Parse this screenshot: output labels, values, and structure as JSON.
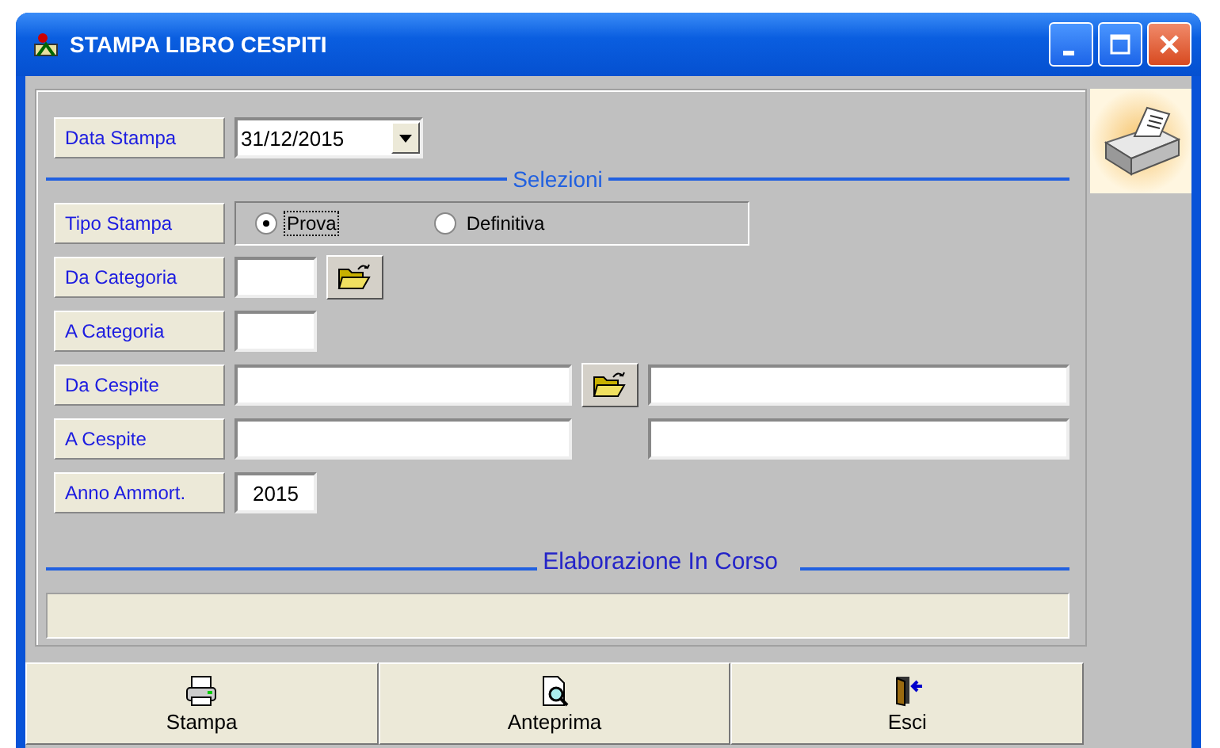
{
  "window": {
    "title": "STAMPA LIBRO CESPITI"
  },
  "data_stampa": {
    "label": "Data Stampa",
    "value": "31/12/2015"
  },
  "selezioni": {
    "title": "Selezioni"
  },
  "tipo_stampa": {
    "label": "Tipo Stampa",
    "options": [
      {
        "label": "Prova",
        "selected": true
      },
      {
        "label": "Definitiva",
        "selected": false
      }
    ]
  },
  "rows": [
    {
      "kind": "short",
      "label": "Da Categoria",
      "browse": true
    },
    {
      "kind": "short",
      "label": "A Categoria",
      "browse": false
    },
    {
      "kind": "wide",
      "label": "Da Cespite",
      "browse": true
    },
    {
      "kind": "wide",
      "label": "A Cespite",
      "browse": false
    },
    {
      "kind": "short",
      "label": "Anno Ammort.",
      "browse": false,
      "value": "2015"
    }
  ],
  "progress": {
    "title": "Elaborazione In Corso"
  },
  "buttons": [
    {
      "kind": "print",
      "label": "Stampa"
    },
    {
      "kind": "preview",
      "label": "Anteprima"
    },
    {
      "kind": "exit",
      "label": "Esci"
    }
  ]
}
